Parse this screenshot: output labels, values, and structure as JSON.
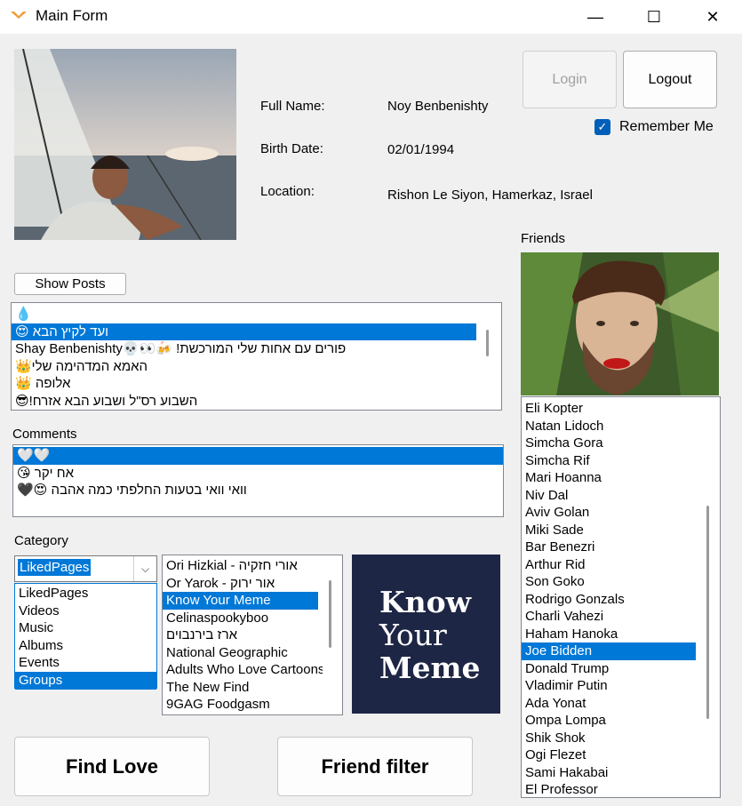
{
  "window": {
    "title": "Main Form",
    "icon": "app-logo-icon",
    "minimize": "—",
    "maximize": "☐",
    "close": "✕"
  },
  "profile": {
    "full_name_label": "Full Name:",
    "full_name": "Noy Benbenishty",
    "birth_date_label": "Birth Date:",
    "birth_date": "02/01/1994",
    "location_label": "Location:",
    "location": "Rishon Le Siyon, Hamerkaz, Israel"
  },
  "auth": {
    "login": "Login",
    "logout": "Logout",
    "remember_me": "Remember Me",
    "remember_checked": true
  },
  "posts": {
    "show_button": "Show Posts",
    "items": [
      "💧",
      "ועד לקיץ הבא 😍",
      "פורים עם אחות שלי המורכשת! 🍻👀💀Shay Benbenishty",
      "האמא המדהימה שלי👑",
      "אלופה 👑",
      "השבוע רס\"ל ושבוע הבא אזרח!😎"
    ],
    "selected_index": 1
  },
  "comments": {
    "label": "Comments",
    "items": [
      "🤍🤍",
      "אח יקר 😘",
      "וואי וואי בטעות החלפתי כמה אהבה 😍🖤"
    ],
    "selected_index": 0
  },
  "category": {
    "label": "Category",
    "selected": "LikedPages",
    "options": [
      "LikedPages",
      "Videos",
      "Music",
      "Albums",
      "Events",
      "Groups"
    ],
    "highlighted_index": 5
  },
  "pages": {
    "items": [
      "אורי חזקיה - Ori Hizkial",
      "אור ירוק - Or Yarok",
      "Know Your Meme",
      "Celinaspookyboo",
      "ארז בירנבוים",
      "National Geographic",
      "Adults Who Love Cartoons",
      "The New Find",
      "9GAG Foodgasm"
    ],
    "selected_index": 2,
    "logo_lines": [
      "Know",
      "Your",
      "Meme"
    ]
  },
  "friends": {
    "label": "Friends",
    "items": [
      "Eli Kopter",
      "Natan Lidoch",
      "Simcha Gora",
      "Simcha Rif",
      "Mari Hoanna",
      "Niv Dal",
      "Aviv Golan",
      "Miki Sade",
      "Bar Benezri",
      "Arthur Rid",
      "Son Goko",
      "Rodrigo Gonzals",
      "Charli Vahezi",
      "Haham Hanoka",
      "Joe Bidden",
      "Donald Trump",
      "Vladimir Putin",
      "Ada Yonat",
      "Ompa Lompa",
      "Shik Shok",
      "Ogi Flezet",
      "Sami Hakabai",
      "El Professor"
    ],
    "selected_index": 14
  },
  "actions": {
    "find_love": "Find Love",
    "friend_filter": "Friend filter"
  }
}
